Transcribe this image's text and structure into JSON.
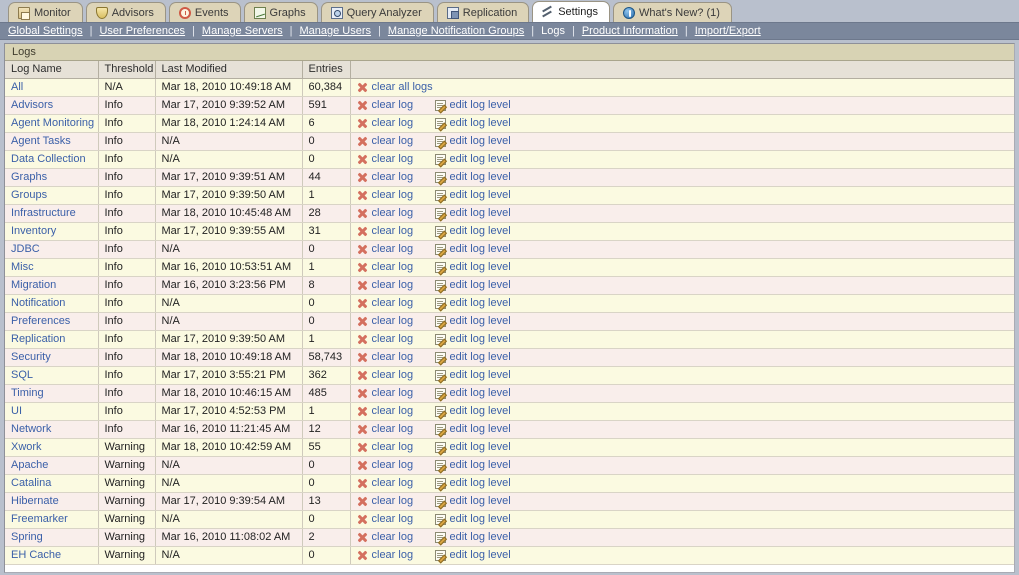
{
  "tabs": [
    {
      "label": "Monitor",
      "icon": "home-icon",
      "active": false
    },
    {
      "label": "Advisors",
      "icon": "shield-icon",
      "active": false
    },
    {
      "label": "Events",
      "icon": "clock-icon",
      "active": false
    },
    {
      "label": "Graphs",
      "icon": "chart-icon",
      "active": false
    },
    {
      "label": "Query Analyzer",
      "icon": "magnify-icon",
      "active": false
    },
    {
      "label": "Replication",
      "icon": "replication-icon",
      "active": false
    },
    {
      "label": "Settings",
      "icon": "settings-icon",
      "active": true
    },
    {
      "label": "What's New? (1)",
      "icon": "info-icon",
      "active": false
    }
  ],
  "subnav": {
    "items": [
      {
        "label": "Global Settings",
        "current": false
      },
      {
        "label": "User Preferences",
        "current": false
      },
      {
        "label": "Manage Servers",
        "current": false
      },
      {
        "label": "Manage Users",
        "current": false
      },
      {
        "label": "Manage Notification Groups",
        "current": false
      },
      {
        "label": "Logs",
        "current": true
      },
      {
        "label": "Product Information",
        "current": false
      },
      {
        "label": "Import/Export",
        "current": false
      }
    ],
    "separator": "|"
  },
  "panel": {
    "title": "Logs"
  },
  "table": {
    "columns": [
      "Log Name",
      "Threshold",
      "Last Modified",
      "Entries",
      ""
    ],
    "actions": {
      "clear_all_label": "clear all logs",
      "clear_label": "clear log",
      "edit_label": "edit log level",
      "clear_icon": "clear-x-icon",
      "edit_icon": "edit-document-icon"
    },
    "rows": [
      {
        "name": "All",
        "threshold": "N/A",
        "modified": "Mar 18, 2010 10:49:18 AM",
        "entries": "60,384",
        "clear_all": true
      },
      {
        "name": "Advisors",
        "threshold": "Info",
        "modified": "Mar 17, 2010 9:39:52 AM",
        "entries": "591",
        "clear_all": false
      },
      {
        "name": "Agent Monitoring",
        "threshold": "Info",
        "modified": "Mar 18, 2010 1:24:14 AM",
        "entries": "6",
        "clear_all": false
      },
      {
        "name": "Agent Tasks",
        "threshold": "Info",
        "modified": "N/A",
        "entries": "0",
        "clear_all": false
      },
      {
        "name": "Data Collection",
        "threshold": "Info",
        "modified": "N/A",
        "entries": "0",
        "clear_all": false
      },
      {
        "name": "Graphs",
        "threshold": "Info",
        "modified": "Mar 17, 2010 9:39:51 AM",
        "entries": "44",
        "clear_all": false
      },
      {
        "name": "Groups",
        "threshold": "Info",
        "modified": "Mar 17, 2010 9:39:50 AM",
        "entries": "1",
        "clear_all": false
      },
      {
        "name": "Infrastructure",
        "threshold": "Info",
        "modified": "Mar 18, 2010 10:45:48 AM",
        "entries": "28",
        "clear_all": false
      },
      {
        "name": "Inventory",
        "threshold": "Info",
        "modified": "Mar 17, 2010 9:39:55 AM",
        "entries": "31",
        "clear_all": false
      },
      {
        "name": "JDBC",
        "threshold": "Info",
        "modified": "N/A",
        "entries": "0",
        "clear_all": false
      },
      {
        "name": "Misc",
        "threshold": "Info",
        "modified": "Mar 16, 2010 10:53:51 AM",
        "entries": "1",
        "clear_all": false
      },
      {
        "name": "Migration",
        "threshold": "Info",
        "modified": "Mar 16, 2010 3:23:56 PM",
        "entries": "8",
        "clear_all": false
      },
      {
        "name": "Notification",
        "threshold": "Info",
        "modified": "N/A",
        "entries": "0",
        "clear_all": false
      },
      {
        "name": "Preferences",
        "threshold": "Info",
        "modified": "N/A",
        "entries": "0",
        "clear_all": false
      },
      {
        "name": "Replication",
        "threshold": "Info",
        "modified": "Mar 17, 2010 9:39:50 AM",
        "entries": "1",
        "clear_all": false
      },
      {
        "name": "Security",
        "threshold": "Info",
        "modified": "Mar 18, 2010 10:49:18 AM",
        "entries": "58,743",
        "clear_all": false
      },
      {
        "name": "SQL",
        "threshold": "Info",
        "modified": "Mar 17, 2010 3:55:21 PM",
        "entries": "362",
        "clear_all": false
      },
      {
        "name": "Timing",
        "threshold": "Info",
        "modified": "Mar 18, 2010 10:46:15 AM",
        "entries": "485",
        "clear_all": false
      },
      {
        "name": "UI",
        "threshold": "Info",
        "modified": "Mar 17, 2010 4:52:53 PM",
        "entries": "1",
        "clear_all": false
      },
      {
        "name": "Network",
        "threshold": "Info",
        "modified": "Mar 16, 2010 11:21:45 AM",
        "entries": "12",
        "clear_all": false
      },
      {
        "name": "Xwork",
        "threshold": "Warning",
        "modified": "Mar 18, 2010 10:42:59 AM",
        "entries": "55",
        "clear_all": false
      },
      {
        "name": "Apache",
        "threshold": "Warning",
        "modified": "N/A",
        "entries": "0",
        "clear_all": false
      },
      {
        "name": "Catalina",
        "threshold": "Warning",
        "modified": "N/A",
        "entries": "0",
        "clear_all": false
      },
      {
        "name": "Hibernate",
        "threshold": "Warning",
        "modified": "Mar 17, 2010 9:39:54 AM",
        "entries": "13",
        "clear_all": false
      },
      {
        "name": "Freemarker",
        "threshold": "Warning",
        "modified": "N/A",
        "entries": "0",
        "clear_all": false
      },
      {
        "name": "Spring",
        "threshold": "Warning",
        "modified": "Mar 16, 2010 11:08:02 AM",
        "entries": "2",
        "clear_all": false
      },
      {
        "name": "EH Cache",
        "threshold": "Warning",
        "modified": "N/A",
        "entries": "0",
        "clear_all": false
      }
    ]
  },
  "colors": {
    "chrome": "#b9c0cd",
    "subnav": "#7b879c",
    "tab_inactive": "#ddd4b8",
    "tab_active": "#ffffff",
    "panel_title": "#d8d3b4",
    "row_odd": "#fbfae1",
    "row_even": "#f9eeeb",
    "link": "#3a5fa8",
    "clear_icon": "#d4705f"
  }
}
